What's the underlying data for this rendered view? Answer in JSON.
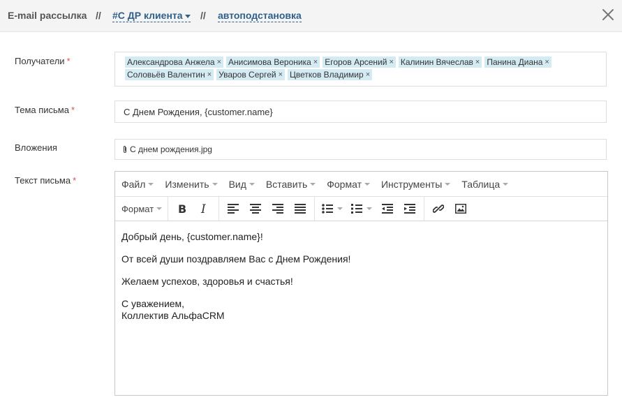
{
  "header": {
    "title": "E-mail рассылка",
    "separator": "//",
    "template_link": "#С ДР клиента",
    "autosubstitution_link": "автоподстановка"
  },
  "form": {
    "recipients_label": "Получатели",
    "subject_label": "Тема письма",
    "attachments_label": "Вложения",
    "body_label": "Текст письма",
    "required_mark": "*",
    "recipients": [
      "Александрова Анжела",
      "Анисимова Вероника",
      "Егоров Арсений",
      "Калинин Вячеслав",
      "Панина Диана",
      "Соловьёв Валентин",
      "Уваров Сергей",
      "Цветков Владимир"
    ],
    "tag_remove_symbol": "×",
    "subject_value": "С Днем Рождения, {customer.name}",
    "attachment_name": "С днем рождения.jpg"
  },
  "editor": {
    "menu": [
      "Файл",
      "Изменить",
      "Вид",
      "Вставить",
      "Формат",
      "Инструменты",
      "Таблица"
    ],
    "toolbar_format_label": "Формат",
    "toolbar_icons": [
      "bold-icon",
      "italic-icon",
      "align-left-icon",
      "align-center-icon",
      "align-right-icon",
      "align-justify-icon",
      "bullet-list-icon",
      "numbered-list-icon",
      "outdent-icon",
      "indent-icon",
      "link-icon",
      "image-icon"
    ],
    "content": {
      "greeting": "Добрый день, {customer.name}!",
      "line2": "От всей души поздравляем Вас с Днем Рождения!",
      "line3": "Желаем успехов, здоровья и счастья!",
      "signature_line1": "С уважением,",
      "signature_line2": "Коллектив АльфаCRM"
    }
  },
  "colors": {
    "header_bg": "#f4f4f4",
    "link": "#2f5f8a",
    "tag_bg": "#d4ebf4",
    "required": "#d9534f"
  }
}
